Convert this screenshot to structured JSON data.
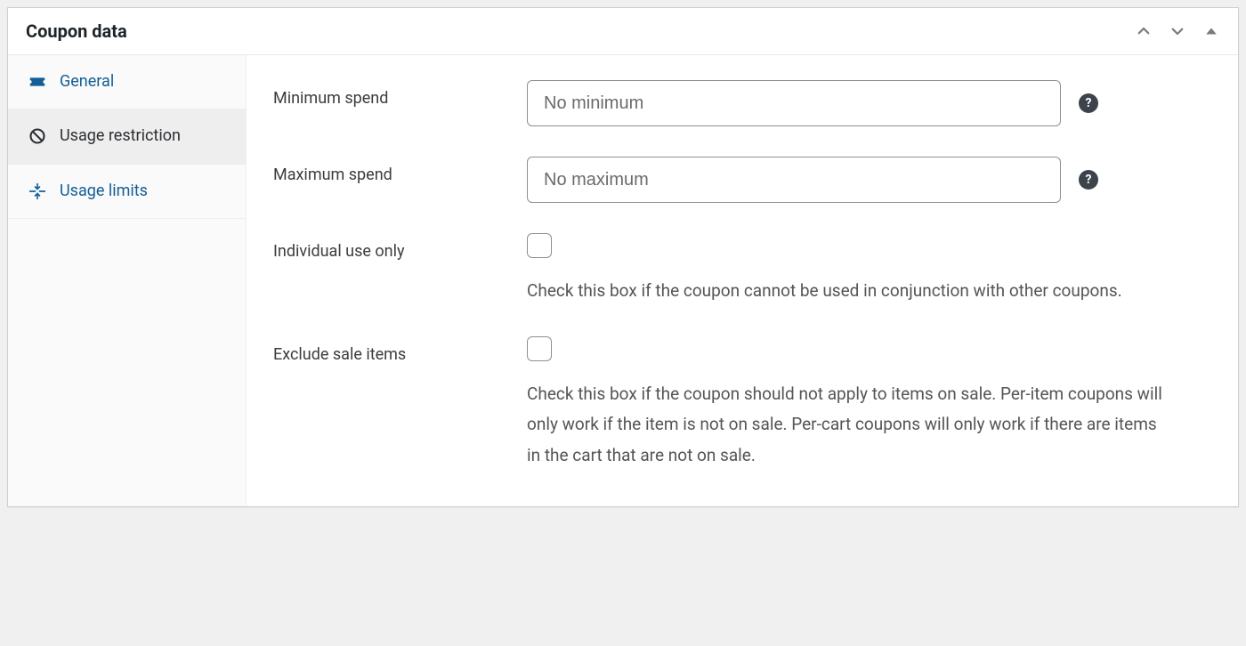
{
  "panel": {
    "title": "Coupon data"
  },
  "tabs": {
    "general": {
      "label": "General"
    },
    "restrict": {
      "label": "Usage restriction"
    },
    "limits": {
      "label": "Usage limits"
    }
  },
  "fields": {
    "min_spend": {
      "label": "Minimum spend",
      "placeholder": "No minimum"
    },
    "max_spend": {
      "label": "Maximum spend",
      "placeholder": "No maximum"
    },
    "individual_use": {
      "label": "Individual use only",
      "description": "Check this box if the coupon cannot be used in conjunction with other coupons."
    },
    "exclude_sale": {
      "label": "Exclude sale items",
      "description": "Check this box if the coupon should not apply to items on sale. Per-item coupons will only work if the item is not on sale. Per-cart coupons will only work if there are items in the cart that are not on sale."
    }
  }
}
